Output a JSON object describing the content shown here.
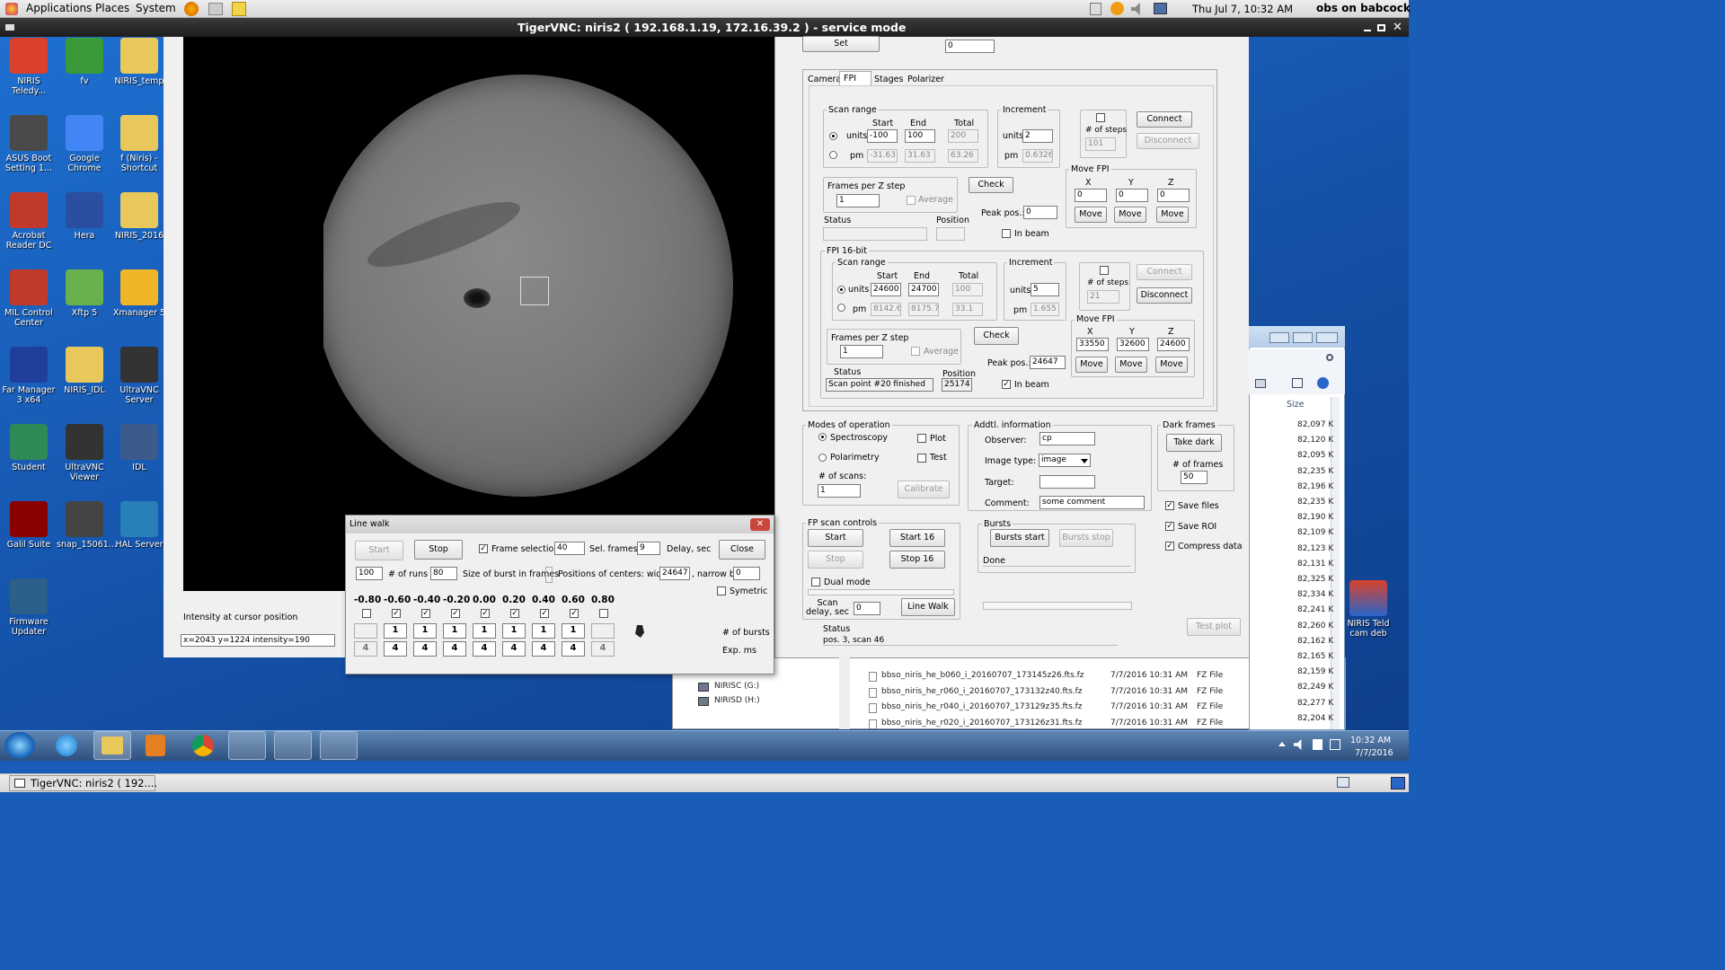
{
  "topbar": {
    "menus": [
      "Applications",
      "Places",
      "System"
    ],
    "clock": "Thu Jul  7, 10:32 AM",
    "user": "obs on babcock"
  },
  "vnc": {
    "title": "TigerVNC: niris2 ( 192.168.1.19, 172.16.39.2 ) - service mode"
  },
  "desktop": {
    "icons": [
      {
        "label": "NIRIS Teledy...",
        "color": "#d9412b"
      },
      {
        "label": "fv",
        "color": "#3a9a3a"
      },
      {
        "label": "NIRIS_temp",
        "color": "#e8c85a"
      },
      {
        "label": "ASUS Boot Setting 1...",
        "color": "#4a4a4a"
      },
      {
        "label": "Google Chrome",
        "color": "#4285f4"
      },
      {
        "label": "f (Niris) - Shortcut",
        "color": "#e8c85a"
      },
      {
        "label": "Acrobat Reader DC",
        "color": "#c0392b"
      },
      {
        "label": "Hera",
        "color": "#2a4fa0"
      },
      {
        "label": "NIRIS_2016",
        "color": "#e8c85a"
      },
      {
        "label": "MIL Control Center",
        "color": "#c0392b"
      },
      {
        "label": "Xftp 5",
        "color": "#6ab04c"
      },
      {
        "label": "Xmanager 5",
        "color": "#f0b429"
      },
      {
        "label": "Far Manager 3 x64",
        "color": "#1f3f9a"
      },
      {
        "label": "NIRIS_IDL",
        "color": "#e8c85a"
      },
      {
        "label": "UltraVNC Server",
        "color": "#333333"
      },
      {
        "label": "Student",
        "color": "#2e8b57"
      },
      {
        "label": "UltraVNC Viewer",
        "color": "#333333"
      },
      {
        "label": "IDL",
        "color": "#3b5b8c"
      },
      {
        "label": "Galil Suite",
        "color": "#8b0000"
      },
      {
        "label": "snap_15061...",
        "color": "#444444"
      },
      {
        "label": "HAL Server",
        "color": "#2980b9"
      },
      {
        "label": "Firmware Updater",
        "color": "#2c5f8a"
      }
    ],
    "right_icon": "NIRIS Teld cam deb"
  },
  "viewer": {
    "cursor_label": "Intensity at cursor position",
    "cursor_value": "x=2043 y=1224  intensity=190"
  },
  "control": {
    "set_label": "Set",
    "set_value": "0",
    "tabs": [
      "Camera",
      "FPI",
      "Stages",
      "Polarizer"
    ],
    "fpi": {
      "scan_range": "Scan range",
      "start": "Start",
      "end": "End",
      "total": "Total",
      "units": "units",
      "pm": "pm",
      "u_start": "-100",
      "u_end": "100",
      "u_total": "200",
      "p_start": "-31.63",
      "p_end": "31.63",
      "p_total": "63.26",
      "increment": "Increment",
      "inc_units": "2",
      "inc_pm": "0.6326",
      "steps_label": "# of steps",
      "steps": "101",
      "connect": "Connect",
      "disconnect": "Disconnect",
      "frames_label": "Frames per Z step",
      "frames": "1",
      "average": "Average",
      "check": "Check",
      "peak_label": "Peak pos.:",
      "peak": "0",
      "status_label": "Status",
      "position_label": "Position",
      "inbeam": "In beam",
      "move_fpi": "Move FPI",
      "x": "X",
      "y": "Y",
      "z": "Z",
      "mx": "0",
      "my": "0",
      "mz": "0",
      "move": "Move"
    },
    "fpi16": {
      "title": "FPI 16-bit",
      "u_start": "24600",
      "u_end": "24700",
      "u_total": "100",
      "p_start": "8142.6",
      "p_end": "8175.7",
      "p_total": "33.1",
      "inc_units": "5",
      "inc_pm": "1.655",
      "steps": "21",
      "peak": "24647",
      "status": "Scan point #20 finished",
      "position": "25174",
      "mx": "33550",
      "my": "32600",
      "mz": "24600"
    },
    "modes": {
      "title": "Modes of operation",
      "spectroscopy": "Spectroscopy",
      "polarimetry": "Polarimetry",
      "plot": "Plot",
      "test": "Test",
      "scans_label": "# of scans:",
      "scans": "1",
      "calibrate": "Calibrate"
    },
    "addl": {
      "title": "Addtl. information",
      "observer_label": "Observer:",
      "observer": "cp",
      "type_label": "Image type:",
      "type": "image",
      "target_label": "Target:",
      "target": "",
      "comment_label": "Comment:",
      "comment": "some comment"
    },
    "dark": {
      "title": "Dark frames",
      "take": "Take dark",
      "frames_label": "# of frames",
      "frames": "50"
    },
    "saves": {
      "save_files": "Save files",
      "save_roi": "Save ROI",
      "compress": "Compress data"
    },
    "fpscan": {
      "title": "FP scan controls",
      "start": "Start",
      "start16": "Start 16",
      "stop": "Stop",
      "stop16": "Stop 16",
      "dual": "Dual mode",
      "delay_label": "Scan delay, sec",
      "delay": "0",
      "linewalk": "Line Walk"
    },
    "bursts": {
      "title": "Bursts",
      "start": "Bursts start",
      "stop": "Bursts stop",
      "status": "Done"
    },
    "status_label": "Status",
    "status": "pos. 3, scan 46",
    "testplot": "Test plot"
  },
  "linewalk": {
    "title": "Line walk",
    "start": "Start",
    "stop": "Stop",
    "frame_sel": "Frame selection",
    "frame_sel_val": "40",
    "sel_frames": "Sel. frames",
    "delay_val": "9",
    "delay": "Delay, sec",
    "close": "Close",
    "runs_val": "100",
    "runs": "# of runs",
    "burst_val": "80",
    "burst": "Size of burst in frames",
    "positions": "Positions of centers:  wide b.",
    "wide": "24647",
    "narrow": ", narrow b.",
    "narrow_val": "0",
    "symetric": "Symetric",
    "cols": [
      "-0.80",
      "-0.60",
      "-0.40",
      "-0.20",
      "0.00",
      "0.20",
      "0.40",
      "0.60",
      "0.80"
    ],
    "checked": [
      false,
      true,
      true,
      true,
      true,
      true,
      true,
      true,
      false
    ],
    "bursts": [
      "",
      "1",
      "1",
      "1",
      "1",
      "1",
      "1",
      "1",
      ""
    ],
    "exps": [
      "4",
      "4",
      "4",
      "4",
      "4",
      "4",
      "4",
      "4",
      "4"
    ],
    "bursts_label": "# of bursts",
    "exp_label": "Exp. ms"
  },
  "explorer": {
    "size_header": "Size",
    "sizes": [
      "82,097 K",
      "82,120 K",
      "82,095 K",
      "82,235 K",
      "82,196 K",
      "82,235 K",
      "82,190 K",
      "82,109 K",
      "82,123 K",
      "82,131 K",
      "82,325 K",
      "82,334 K",
      "82,241 K",
      "82,260 K",
      "82,162 K",
      "82,165 K",
      "82,159 K",
      "82,249 K",
      "82,277 K",
      "82,204 K"
    ],
    "drives": [
      "NIRISC (G:)",
      "NIRISD (H:)"
    ],
    "files": [
      {
        "name": "bbso_niris_he_b060_i_20160707_173145z26.fts.fz",
        "date": "7/7/2016 10:31 AM",
        "type": "FZ File"
      },
      {
        "name": "bbso_niris_he_r060_i_20160707_173132z40.fts.fz",
        "date": "7/7/2016 10:31 AM",
        "type": "FZ File"
      },
      {
        "name": "bbso_niris_he_r040_i_20160707_173129z35.fts.fz",
        "date": "7/7/2016 10:31 AM",
        "type": "FZ File"
      },
      {
        "name": "bbso_niris_he_r020_i_20160707_173126z31.fts.fz",
        "date": "7/7/2016 10:31 AM",
        "type": "FZ File"
      }
    ]
  },
  "taskbar": {
    "time": "10:32 AM",
    "date": "7/7/2016"
  },
  "bottombar": {
    "item": "TigerVNC: niris2 ( 192...."
  }
}
